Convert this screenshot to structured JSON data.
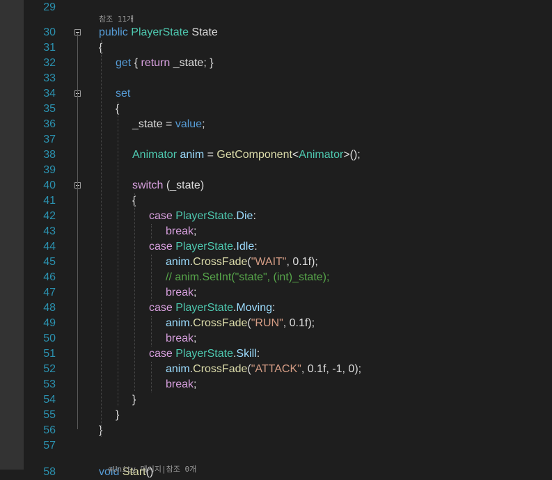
{
  "editor": {
    "codelens_top": "참조 11개",
    "codelens_bottom": "Unity 메시지|참조 0개",
    "codelens_bottom_icon": "unity-icon",
    "lines": [
      {
        "n": "29",
        "tokens": []
      },
      {
        "n": "30",
        "tokens": [
          [
            "kw",
            "public"
          ],
          [
            "plain",
            " "
          ],
          [
            "type",
            "PlayerState"
          ],
          [
            "plain",
            " State"
          ]
        ]
      },
      {
        "n": "31",
        "tokens": [
          [
            "plain",
            "{"
          ]
        ]
      },
      {
        "n": "32",
        "tokens": [
          [
            "kw",
            "get"
          ],
          [
            "plain",
            " { "
          ],
          [
            "ctl",
            "return"
          ],
          [
            "plain",
            " _state; }"
          ]
        ]
      },
      {
        "n": "33",
        "tokens": []
      },
      {
        "n": "34",
        "tokens": [
          [
            "kw",
            "set"
          ]
        ]
      },
      {
        "n": "35",
        "tokens": [
          [
            "plain",
            "{"
          ]
        ]
      },
      {
        "n": "36",
        "tokens": [
          [
            "plain",
            "_state = "
          ],
          [
            "kw",
            "value"
          ],
          [
            "plain",
            ";"
          ]
        ]
      },
      {
        "n": "37",
        "tokens": []
      },
      {
        "n": "38",
        "tokens": [
          [
            "type",
            "Animator"
          ],
          [
            "plain",
            " "
          ],
          [
            "var",
            "anim"
          ],
          [
            "plain",
            " = "
          ],
          [
            "fn",
            "GetComponent"
          ],
          [
            "plain",
            "<"
          ],
          [
            "type",
            "Animator"
          ],
          [
            "plain",
            ">();"
          ]
        ]
      },
      {
        "n": "39",
        "tokens": []
      },
      {
        "n": "40",
        "tokens": [
          [
            "ctl",
            "switch"
          ],
          [
            "plain",
            " (_state)"
          ]
        ]
      },
      {
        "n": "41",
        "tokens": [
          [
            "plain",
            "{"
          ]
        ]
      },
      {
        "n": "42",
        "tokens": [
          [
            "ctl",
            "case"
          ],
          [
            "plain",
            " "
          ],
          [
            "type",
            "PlayerState"
          ],
          [
            "plain",
            "."
          ],
          [
            "var",
            "Die"
          ],
          [
            "plain",
            ":"
          ]
        ]
      },
      {
        "n": "43",
        "tokens": [
          [
            "ctl",
            "break"
          ],
          [
            "plain",
            ";"
          ]
        ]
      },
      {
        "n": "44",
        "tokens": [
          [
            "ctl",
            "case"
          ],
          [
            "plain",
            " "
          ],
          [
            "type",
            "PlayerState"
          ],
          [
            "plain",
            "."
          ],
          [
            "var",
            "Idle"
          ],
          [
            "plain",
            ":"
          ]
        ]
      },
      {
        "n": "45",
        "tokens": [
          [
            "var",
            "anim"
          ],
          [
            "plain",
            "."
          ],
          [
            "fn",
            "CrossFade"
          ],
          [
            "plain",
            "("
          ],
          [
            "str",
            "\"WAIT\""
          ],
          [
            "plain",
            ", 0.1f);"
          ]
        ]
      },
      {
        "n": "46",
        "tokens": [
          [
            "cmt",
            "// anim.SetInt(\"state\", (int)_state);"
          ]
        ]
      },
      {
        "n": "47",
        "tokens": [
          [
            "ctl",
            "break"
          ],
          [
            "plain",
            ";"
          ]
        ]
      },
      {
        "n": "48",
        "tokens": [
          [
            "ctl",
            "case"
          ],
          [
            "plain",
            " "
          ],
          [
            "type",
            "PlayerState"
          ],
          [
            "plain",
            "."
          ],
          [
            "var",
            "Moving"
          ],
          [
            "plain",
            ":"
          ]
        ]
      },
      {
        "n": "49",
        "tokens": [
          [
            "var",
            "anim"
          ],
          [
            "plain",
            "."
          ],
          [
            "fn",
            "CrossFade"
          ],
          [
            "plain",
            "("
          ],
          [
            "str",
            "\"RUN\""
          ],
          [
            "plain",
            ", 0.1f);"
          ]
        ]
      },
      {
        "n": "50",
        "tokens": [
          [
            "ctl",
            "break"
          ],
          [
            "plain",
            ";"
          ]
        ]
      },
      {
        "n": "51",
        "tokens": [
          [
            "ctl",
            "case"
          ],
          [
            "plain",
            " "
          ],
          [
            "type",
            "PlayerState"
          ],
          [
            "plain",
            "."
          ],
          [
            "var",
            "Skill"
          ],
          [
            "plain",
            ":"
          ]
        ]
      },
      {
        "n": "52",
        "tokens": [
          [
            "var",
            "anim"
          ],
          [
            "plain",
            "."
          ],
          [
            "fn",
            "CrossFade"
          ],
          [
            "plain",
            "("
          ],
          [
            "str",
            "\"ATTACK\""
          ],
          [
            "plain",
            ", 0.1f, -1, 0);"
          ]
        ]
      },
      {
        "n": "53",
        "tokens": [
          [
            "ctl",
            "break"
          ],
          [
            "plain",
            ";"
          ]
        ]
      },
      {
        "n": "54",
        "tokens": [
          [
            "plain",
            "}"
          ]
        ]
      },
      {
        "n": "55",
        "tokens": [
          [
            "plain",
            "}"
          ]
        ]
      },
      {
        "n": "56",
        "tokens": [
          [
            "plain",
            "}"
          ]
        ]
      },
      {
        "n": "57",
        "tokens": []
      },
      {
        "n": "58",
        "tokens": [
          [
            "kw",
            "void"
          ],
          [
            "plain",
            " "
          ],
          [
            "fn",
            "Start"
          ],
          [
            "plain",
            "()"
          ]
        ]
      }
    ]
  }
}
